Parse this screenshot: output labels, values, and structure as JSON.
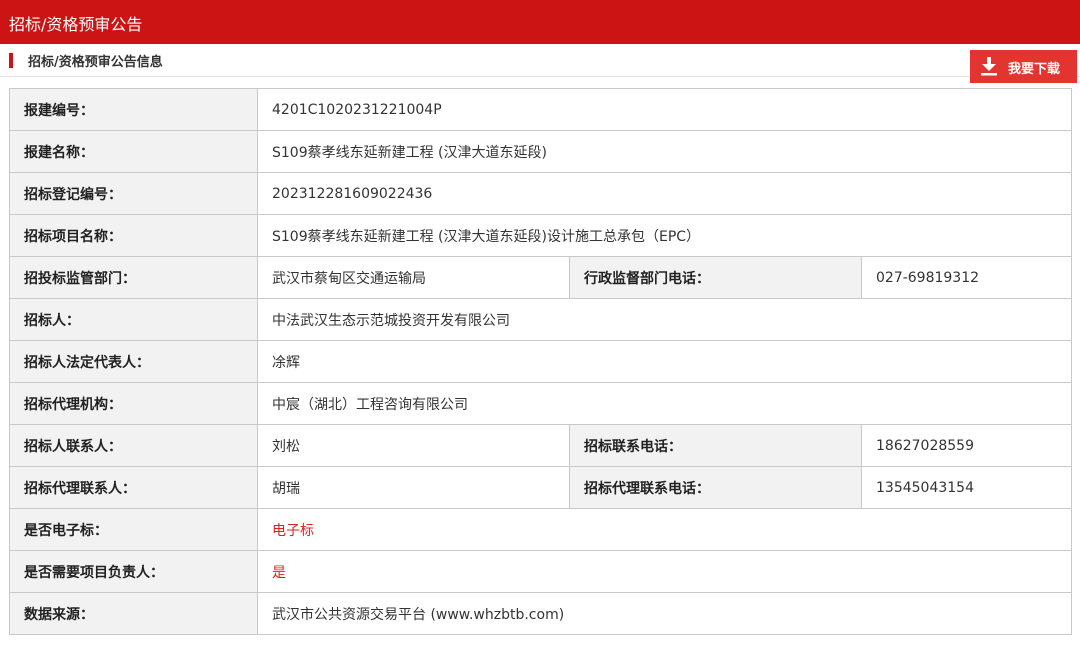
{
  "header": {
    "title": "招标/资格预审公告"
  },
  "section": {
    "title": "招标/资格预审公告信息",
    "download_label": "我要下载",
    "download_icon": "download-icon"
  },
  "colors": {
    "brand_red": "#cc1414",
    "button_red": "#e3342f",
    "highlight_text": "#e02020"
  },
  "rows": [
    {
      "label": "报建编号：",
      "value": "4201C1020231221004P"
    },
    {
      "label": "报建名称：",
      "value": "S109蔡孝线东延新建工程 (汉津大道东延段)"
    },
    {
      "label": "招标登记编号：",
      "value": "202312281609022436"
    },
    {
      "label": "招标项目名称：",
      "value": "S109蔡孝线东延新建工程 (汉津大道东延段)设计施工总承包（EPC）"
    },
    {
      "label": "招投标监管部门：",
      "value": "武汉市蔡甸区交通运输局",
      "label2": "行政监督部门电话：",
      "value2": "027-69819312"
    },
    {
      "label": "招标人：",
      "value": "中法武汉生态示范城投资开发有限公司"
    },
    {
      "label": "招标人法定代表人：",
      "value": "凃辉"
    },
    {
      "label": "招标代理机构：",
      "value": "中宸（湖北）工程咨询有限公司"
    },
    {
      "label": "招标人联系人：",
      "value": "刘松",
      "label2": "招标联系电话：",
      "value2": "18627028559"
    },
    {
      "label": "招标代理联系人：",
      "value": "胡瑞",
      "label2": "招标代理联系电话：",
      "value2": "13545043154"
    },
    {
      "label": "是否电子标：",
      "value": "电子标"
    },
    {
      "label": "是否需要项目负责人：",
      "value": "是"
    },
    {
      "label": "数据来源：",
      "value": "武汉市公共资源交易平台 (www.whzbtb.com)"
    }
  ]
}
